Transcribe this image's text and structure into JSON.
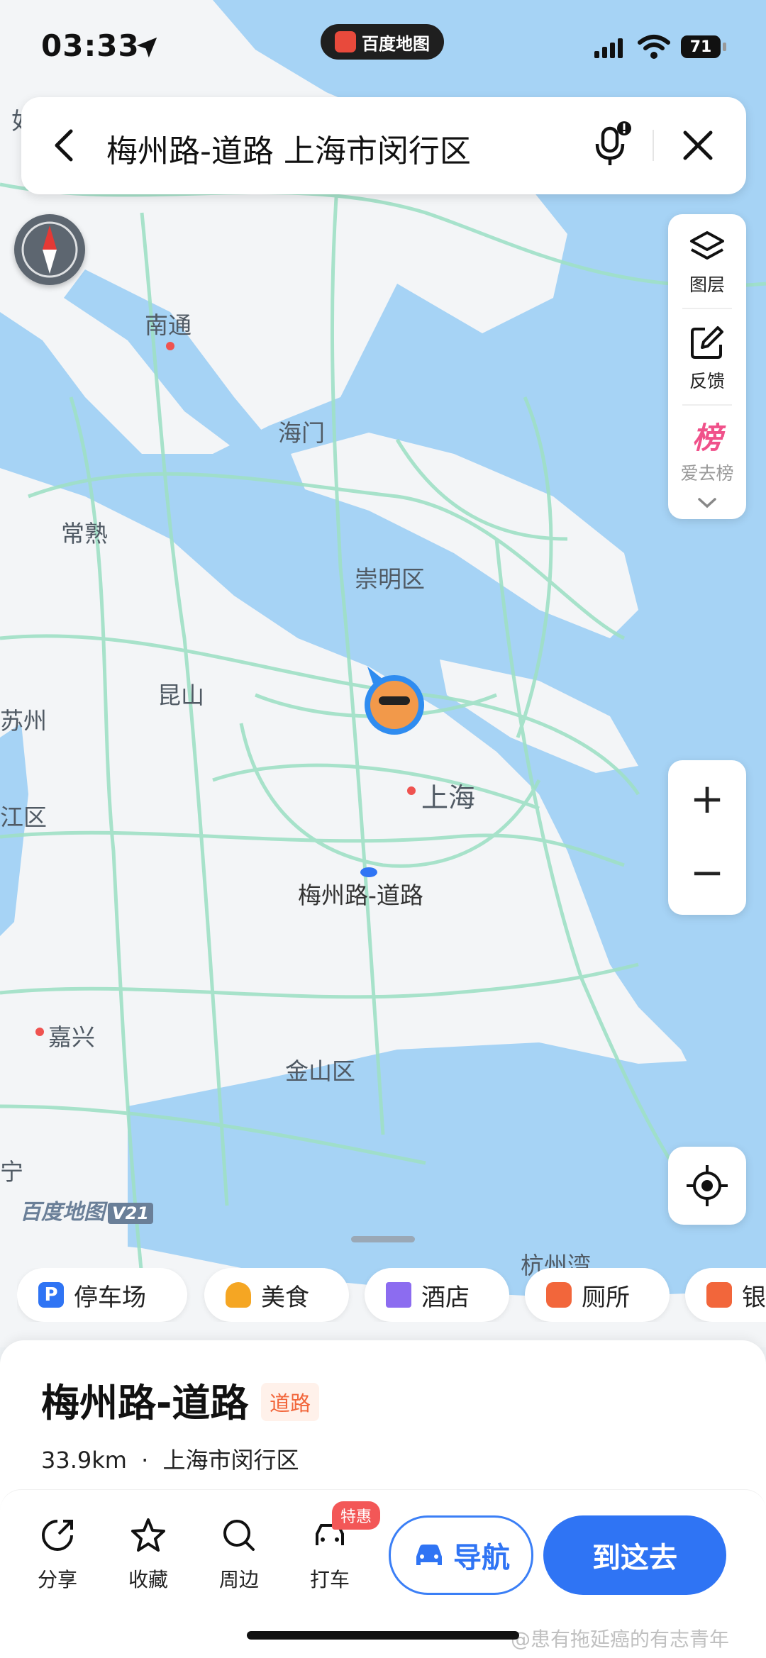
{
  "status_bar": {
    "time": "03:33",
    "app_pill": "百度地图",
    "battery": "71"
  },
  "search": {
    "query": "梅州路-道路 上海市闵行区"
  },
  "map_tools": [
    {
      "label": "图层",
      "icon": "layers-icon"
    },
    {
      "label": "反馈",
      "icon": "feedback-icon"
    },
    {
      "label": "爱去榜",
      "icon": "ranking-icon",
      "badge": "榜"
    }
  ],
  "map_labels": [
    {
      "text": "南通"
    },
    {
      "text": "海门"
    },
    {
      "text": "常熟"
    },
    {
      "text": "崇明区"
    },
    {
      "text": "昆山"
    },
    {
      "text": "苏州"
    },
    {
      "text": "上海"
    },
    {
      "text": "江区"
    },
    {
      "text": "梅州路-道路"
    },
    {
      "text": "嘉兴"
    },
    {
      "text": "金山区"
    },
    {
      "text": "杭州湾"
    },
    {
      "text": "宁"
    },
    {
      "text": "如"
    }
  ],
  "brand": {
    "name": "百度地图",
    "version": "V21"
  },
  "categories": [
    {
      "label": "停车场",
      "icon": "parking-icon",
      "color": "#2f74f4",
      "glyph": "P"
    },
    {
      "label": "美食",
      "icon": "food-icon",
      "color": "#f5a623"
    },
    {
      "label": "酒店",
      "icon": "hotel-icon",
      "color": "#8c6cf0"
    },
    {
      "label": "厕所",
      "icon": "toilet-icon",
      "color": "#f2663b"
    },
    {
      "label": "银",
      "icon": "bank-icon",
      "color": "#f2663b"
    }
  ],
  "place": {
    "title": "梅州路-道路",
    "tag": "道路",
    "distance": "33.9km",
    "separator": "·",
    "district": "上海市闵行区"
  },
  "actions": [
    {
      "label": "分享",
      "icon": "share-icon"
    },
    {
      "label": "收藏",
      "icon": "star-icon"
    },
    {
      "label": "周边",
      "icon": "search-icon"
    },
    {
      "label": "打车",
      "icon": "taxi-icon"
    }
  ],
  "promo_badge": "特惠",
  "navigate_label": "导航",
  "go_label": "到这去",
  "watermark": "@患有拖延癌的有志青年",
  "colors": {
    "water": "#a6d3f5",
    "land": "#f3f5f7",
    "roads": "#9fe0c6",
    "accent": "#2f74f4"
  }
}
